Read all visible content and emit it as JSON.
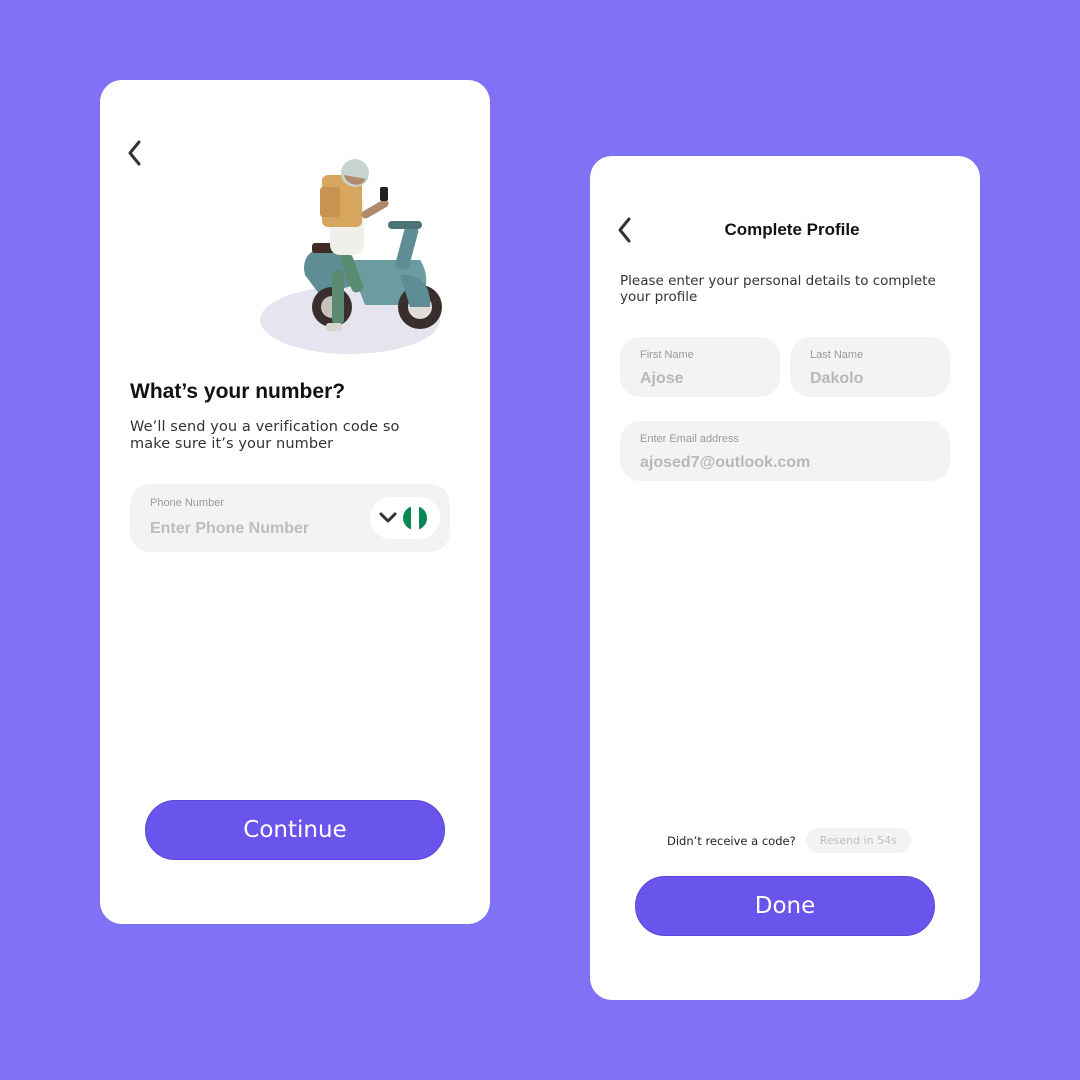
{
  "colors": {
    "background": "#8172F5",
    "accent": "#6A55EC",
    "card": "#FFFFFF",
    "field": "#F3F3F5"
  },
  "phone_screen": {
    "back_icon": "chevron-left-icon",
    "illustration": "delivery-rider-on-scooter-illustration",
    "headline": "What’s your number?",
    "subtext": "We’ll send you a verification code so make sure it’s your number",
    "phone_field": {
      "label": "Phone Number",
      "placeholder": "Enter Phone Number",
      "country_icon": "nigeria-flag-icon",
      "dropdown_icon": "chevron-down-icon"
    },
    "continue_label": "Continue"
  },
  "profile_screen": {
    "back_icon": "chevron-left-icon",
    "title": "Complete Profile",
    "subtext": "Please enter your personal details to complete your profile",
    "first_name": {
      "label": "First Name",
      "value": "Ajose"
    },
    "last_name": {
      "label": "Last Name",
      "value": "Dakolo"
    },
    "email": {
      "label": "Enter Email address",
      "value": "ajosed7@outlook.com"
    },
    "resend_question": "Didn’t receive a code?",
    "resend_timer": "Resend in 54s",
    "done_label": "Done"
  }
}
